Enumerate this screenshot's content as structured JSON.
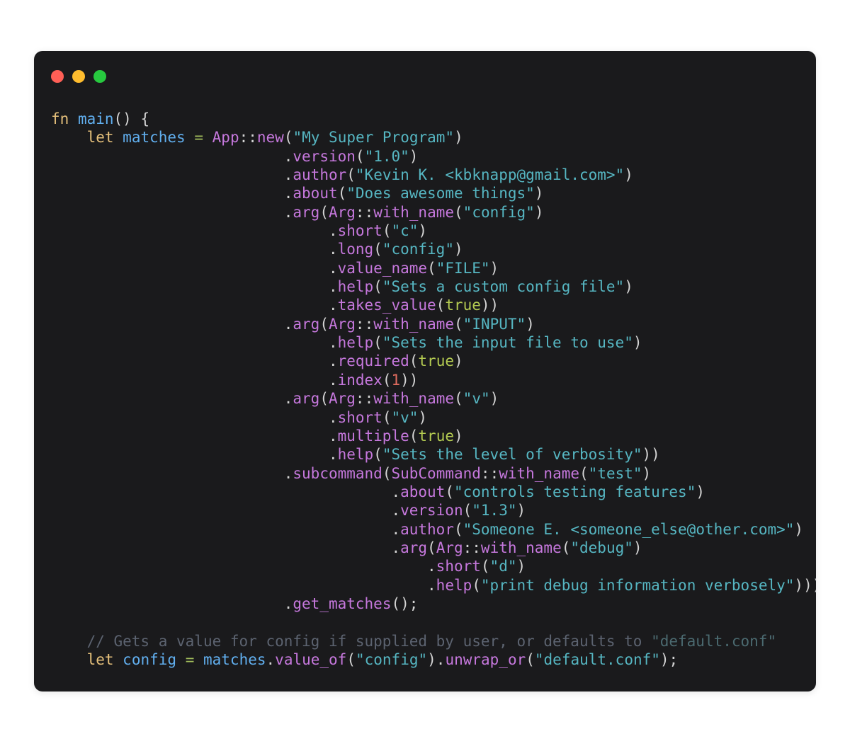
{
  "window": {
    "background_color": "#1a1a1c",
    "page_background_color": "#ffffff",
    "traffic_lights": [
      {
        "name": "close",
        "color": "#ff5f56"
      },
      {
        "name": "minimize",
        "color": "#ffbd2e"
      },
      {
        "name": "maximize",
        "color": "#27c93f"
      }
    ]
  },
  "code": {
    "language": "rust",
    "theme": "one-dark",
    "font_size_px": 21,
    "lines": [
      "fn main() {",
      "    let matches = App::new(\"My Super Program\")",
      "                          .version(\"1.0\")",
      "                          .author(\"Kevin K. <kbknapp@gmail.com>\")",
      "                          .about(\"Does awesome things\")",
      "                          .arg(Arg::with_name(\"config\")",
      "                               .short(\"c\")",
      "                               .long(\"config\")",
      "                               .value_name(\"FILE\")",
      "                               .help(\"Sets a custom config file\")",
      "                               .takes_value(true))",
      "                          .arg(Arg::with_name(\"INPUT\")",
      "                               .help(\"Sets the input file to use\")",
      "                               .required(true)",
      "                               .index(1))",
      "                          .arg(Arg::with_name(\"v\")",
      "                               .short(\"v\")",
      "                               .multiple(true)",
      "                               .help(\"Sets the level of verbosity\"))",
      "                          .subcommand(SubCommand::with_name(\"test\")",
      "                                      .about(\"controls testing features\")",
      "                                      .version(\"1.3\")",
      "                                      .author(\"Someone E. <someone_else@other.com>\")",
      "                                      .arg(Arg::with_name(\"debug\")",
      "                                          .short(\"d\")",
      "                                          .help(\"print debug information verbosely\")))",
      "                          .get_matches();",
      "",
      "    // Gets a value for config if supplied by user, or defaults to \"default.conf\"",
      "    let config = matches.value_of(\"config\").unwrap_or(\"default.conf\");"
    ],
    "tokens": {
      "keyword_color": "#e5c07b",
      "function_color": "#61afef",
      "type_color": "#c678dd",
      "method_color": "#c678dd",
      "string_color": "#56b6c2",
      "boolean_color": "#b5cc52",
      "number_color": "#e06c5f",
      "operator_color": "#a3be5c",
      "punctuation_color": "#d4d4d4",
      "comment_color": "#5c6370"
    }
  }
}
